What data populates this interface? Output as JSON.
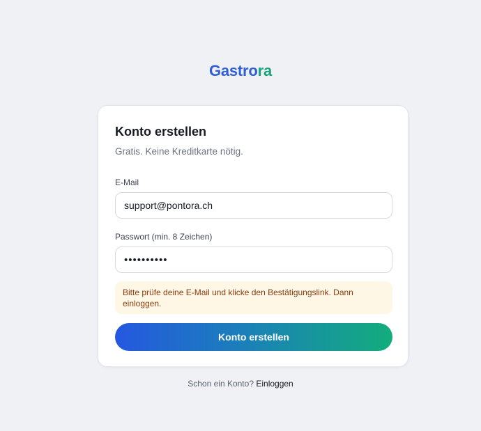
{
  "brand": {
    "part1": "Gastro",
    "part2": "ra"
  },
  "card": {
    "title": "Konto erstellen",
    "subtitle": "Gratis. Keine Kreditkarte nötig."
  },
  "email": {
    "label": "E-Mail",
    "value": "support@pontora.ch"
  },
  "password": {
    "label": "Passwort (min. 8 Zeichen)",
    "masked_value": "••••••••••"
  },
  "alert": {
    "text": "Bitte prüfe deine E-Mail und klicke den Bestätigungslink. Dann einloggen."
  },
  "submit_label": "Konto erstellen",
  "footer": {
    "text": "Schon ein Konto?",
    "link": "Einloggen"
  },
  "colors": {
    "brand_blue": "#2f5fd8",
    "brand_green": "#1aa37a",
    "alert_bg": "#fef7e6",
    "alert_text": "#8a3b10"
  }
}
